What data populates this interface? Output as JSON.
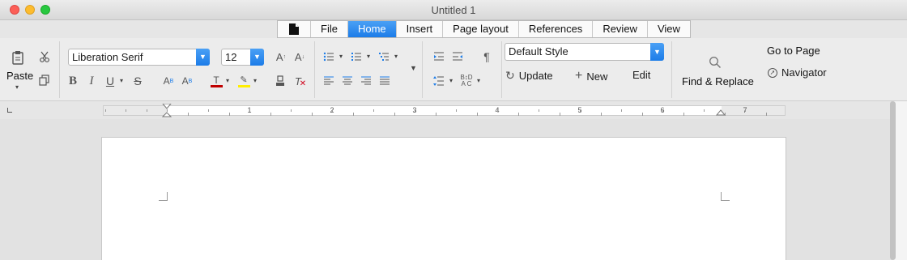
{
  "window": {
    "title": "Untitled 1"
  },
  "tabs": [
    {
      "label": "File"
    },
    {
      "label": "Home"
    },
    {
      "label": "Insert"
    },
    {
      "label": "Page layout"
    },
    {
      "label": "References"
    },
    {
      "label": "Review"
    },
    {
      "label": "View"
    }
  ],
  "active_tab": "Home",
  "clipboard": {
    "paste_label": "Paste"
  },
  "font": {
    "name": "Liberation Serif",
    "size": "12"
  },
  "styles": {
    "current": "Default Style",
    "update_label": "Update",
    "new_label": "New",
    "edit_label": "Edit"
  },
  "find": {
    "find_replace_label": "Find & Replace",
    "goto_label": "Go to Page",
    "navigator_label": "Navigator"
  },
  "ruler": {
    "numbers": [
      "1",
      "2",
      "3",
      "4",
      "5",
      "6",
      "7"
    ]
  },
  "colors": {
    "accent": "#1c7ce8",
    "font_color": "#c00000",
    "highlight": "#ffee00"
  }
}
